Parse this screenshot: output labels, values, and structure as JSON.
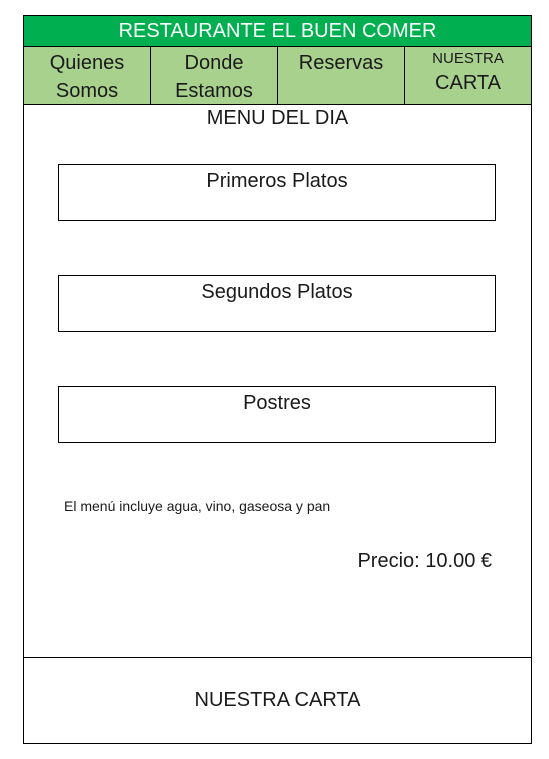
{
  "header": {
    "title": "RESTAURANTE EL BUEN COMER"
  },
  "nav": {
    "items": [
      {
        "line1": "Quienes",
        "line2": "Somos"
      },
      {
        "line1": "Donde",
        "line2": "Estamos"
      },
      {
        "line1": "Reservas"
      },
      {
        "line1": "NUESTRA",
        "line2": "CARTA"
      }
    ]
  },
  "main": {
    "title": "MENU DEL DIA",
    "sections": [
      {
        "label": "Primeros Platos"
      },
      {
        "label": "Segundos Platos"
      },
      {
        "label": "Postres"
      }
    ],
    "note": "El menú incluye agua, vino, gaseosa y pan",
    "price": "Precio: 10.00 €"
  },
  "footer": {
    "label": "NUESTRA CARTA"
  },
  "colors": {
    "title_bar": "#00b050",
    "nav_bar": "#a9d18e"
  }
}
